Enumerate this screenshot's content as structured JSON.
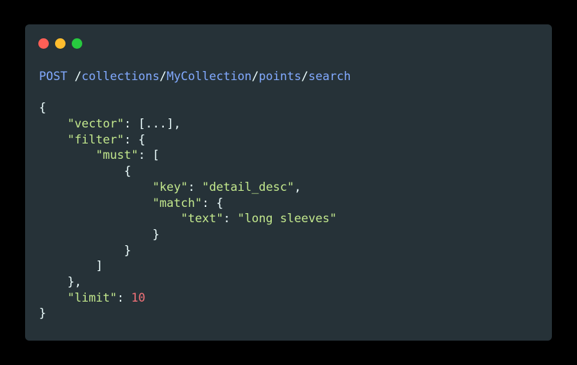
{
  "window": {
    "background": "#263238",
    "controls": [
      {
        "name": "close",
        "color": "#ff5f56"
      },
      {
        "name": "minimize",
        "color": "#ffbd2e"
      },
      {
        "name": "maximize",
        "color": "#27c93f"
      }
    ]
  },
  "request": {
    "method": "POST",
    "path_segments": [
      "collections",
      "MyCollection",
      "points",
      "search"
    ]
  },
  "body": {
    "vector_key": "\"vector\"",
    "vector_value": "[...]",
    "filter_key": "\"filter\"",
    "must_key": "\"must\"",
    "key_key": "\"key\"",
    "key_value": "\"detail_desc\"",
    "match_key": "\"match\"",
    "text_key": "\"text\"",
    "text_value": "\"long sleeves\"",
    "limit_key": "\"limit\"",
    "limit_value": "10"
  }
}
